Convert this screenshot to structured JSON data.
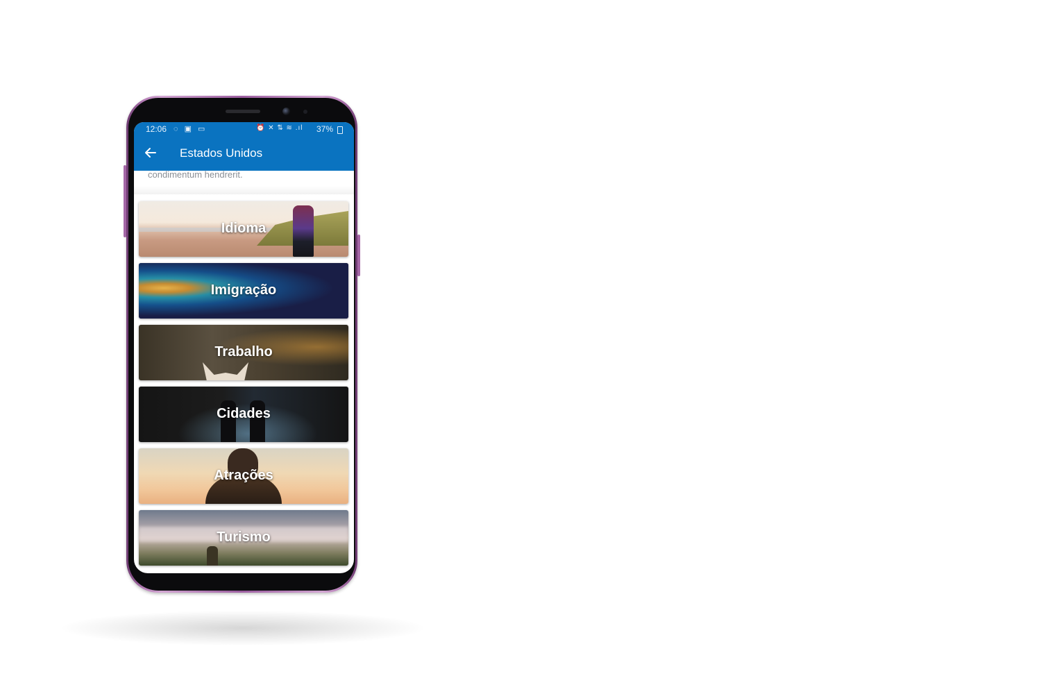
{
  "status_bar": {
    "time": "12:06",
    "left_icons": "◌ ▣ ▭",
    "right_icons": "⏰ ✕ ⇅ ≋ .ıl",
    "battery": "37%"
  },
  "app_bar": {
    "back_icon": "arrow-left",
    "title": "Estados Unidos"
  },
  "content": {
    "description_tail": "condimentum hendrerit.",
    "categories": [
      {
        "label": "Idioma"
      },
      {
        "label": "Imigração"
      },
      {
        "label": "Trabalho"
      },
      {
        "label": "Cidades"
      },
      {
        "label": "Atrações"
      },
      {
        "label": "Turismo"
      }
    ]
  },
  "colors": {
    "primary": "#0a73c0",
    "phone_frame": "#9c5ea0",
    "secondary_text": "#8a8f96"
  }
}
